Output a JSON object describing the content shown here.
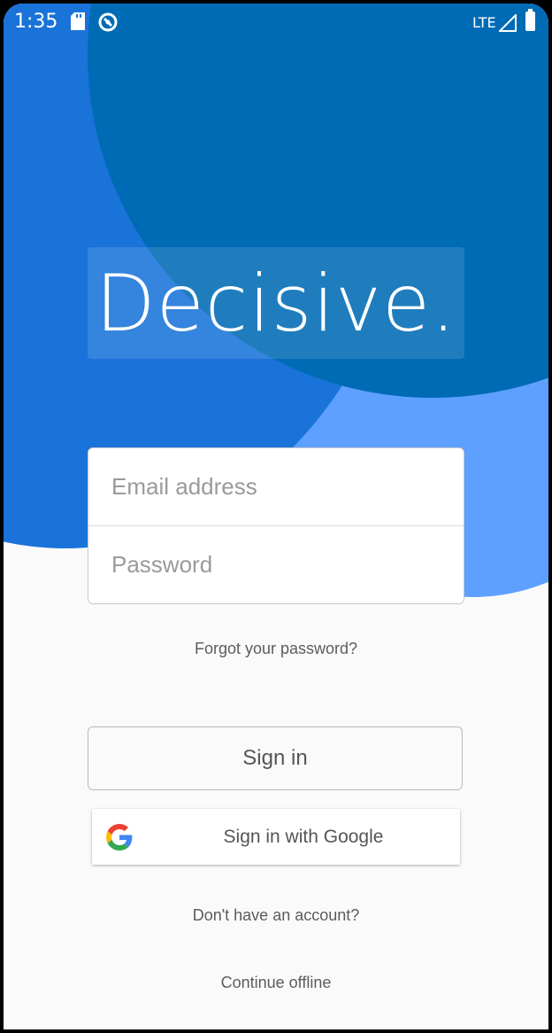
{
  "status_bar": {
    "time": "1:35",
    "network": "LTE",
    "icons": [
      "sd-card-icon",
      "sync-icon",
      "signal-icon",
      "battery-icon"
    ]
  },
  "app": {
    "logo": "Decisive."
  },
  "login": {
    "email_placeholder": "Email address",
    "password_placeholder": "Password",
    "forgot_label": "Forgot your password?",
    "sign_in_label": "Sign in",
    "google_label": "Sign in with Google",
    "no_account_label": "Don't have an account?",
    "offline_label": "Continue offline"
  },
  "colors": {
    "blob_dark": "#006bb5",
    "blob_mid": "#1a73d9",
    "blob_light": "#5ea0ff",
    "background": "#fafafa"
  }
}
